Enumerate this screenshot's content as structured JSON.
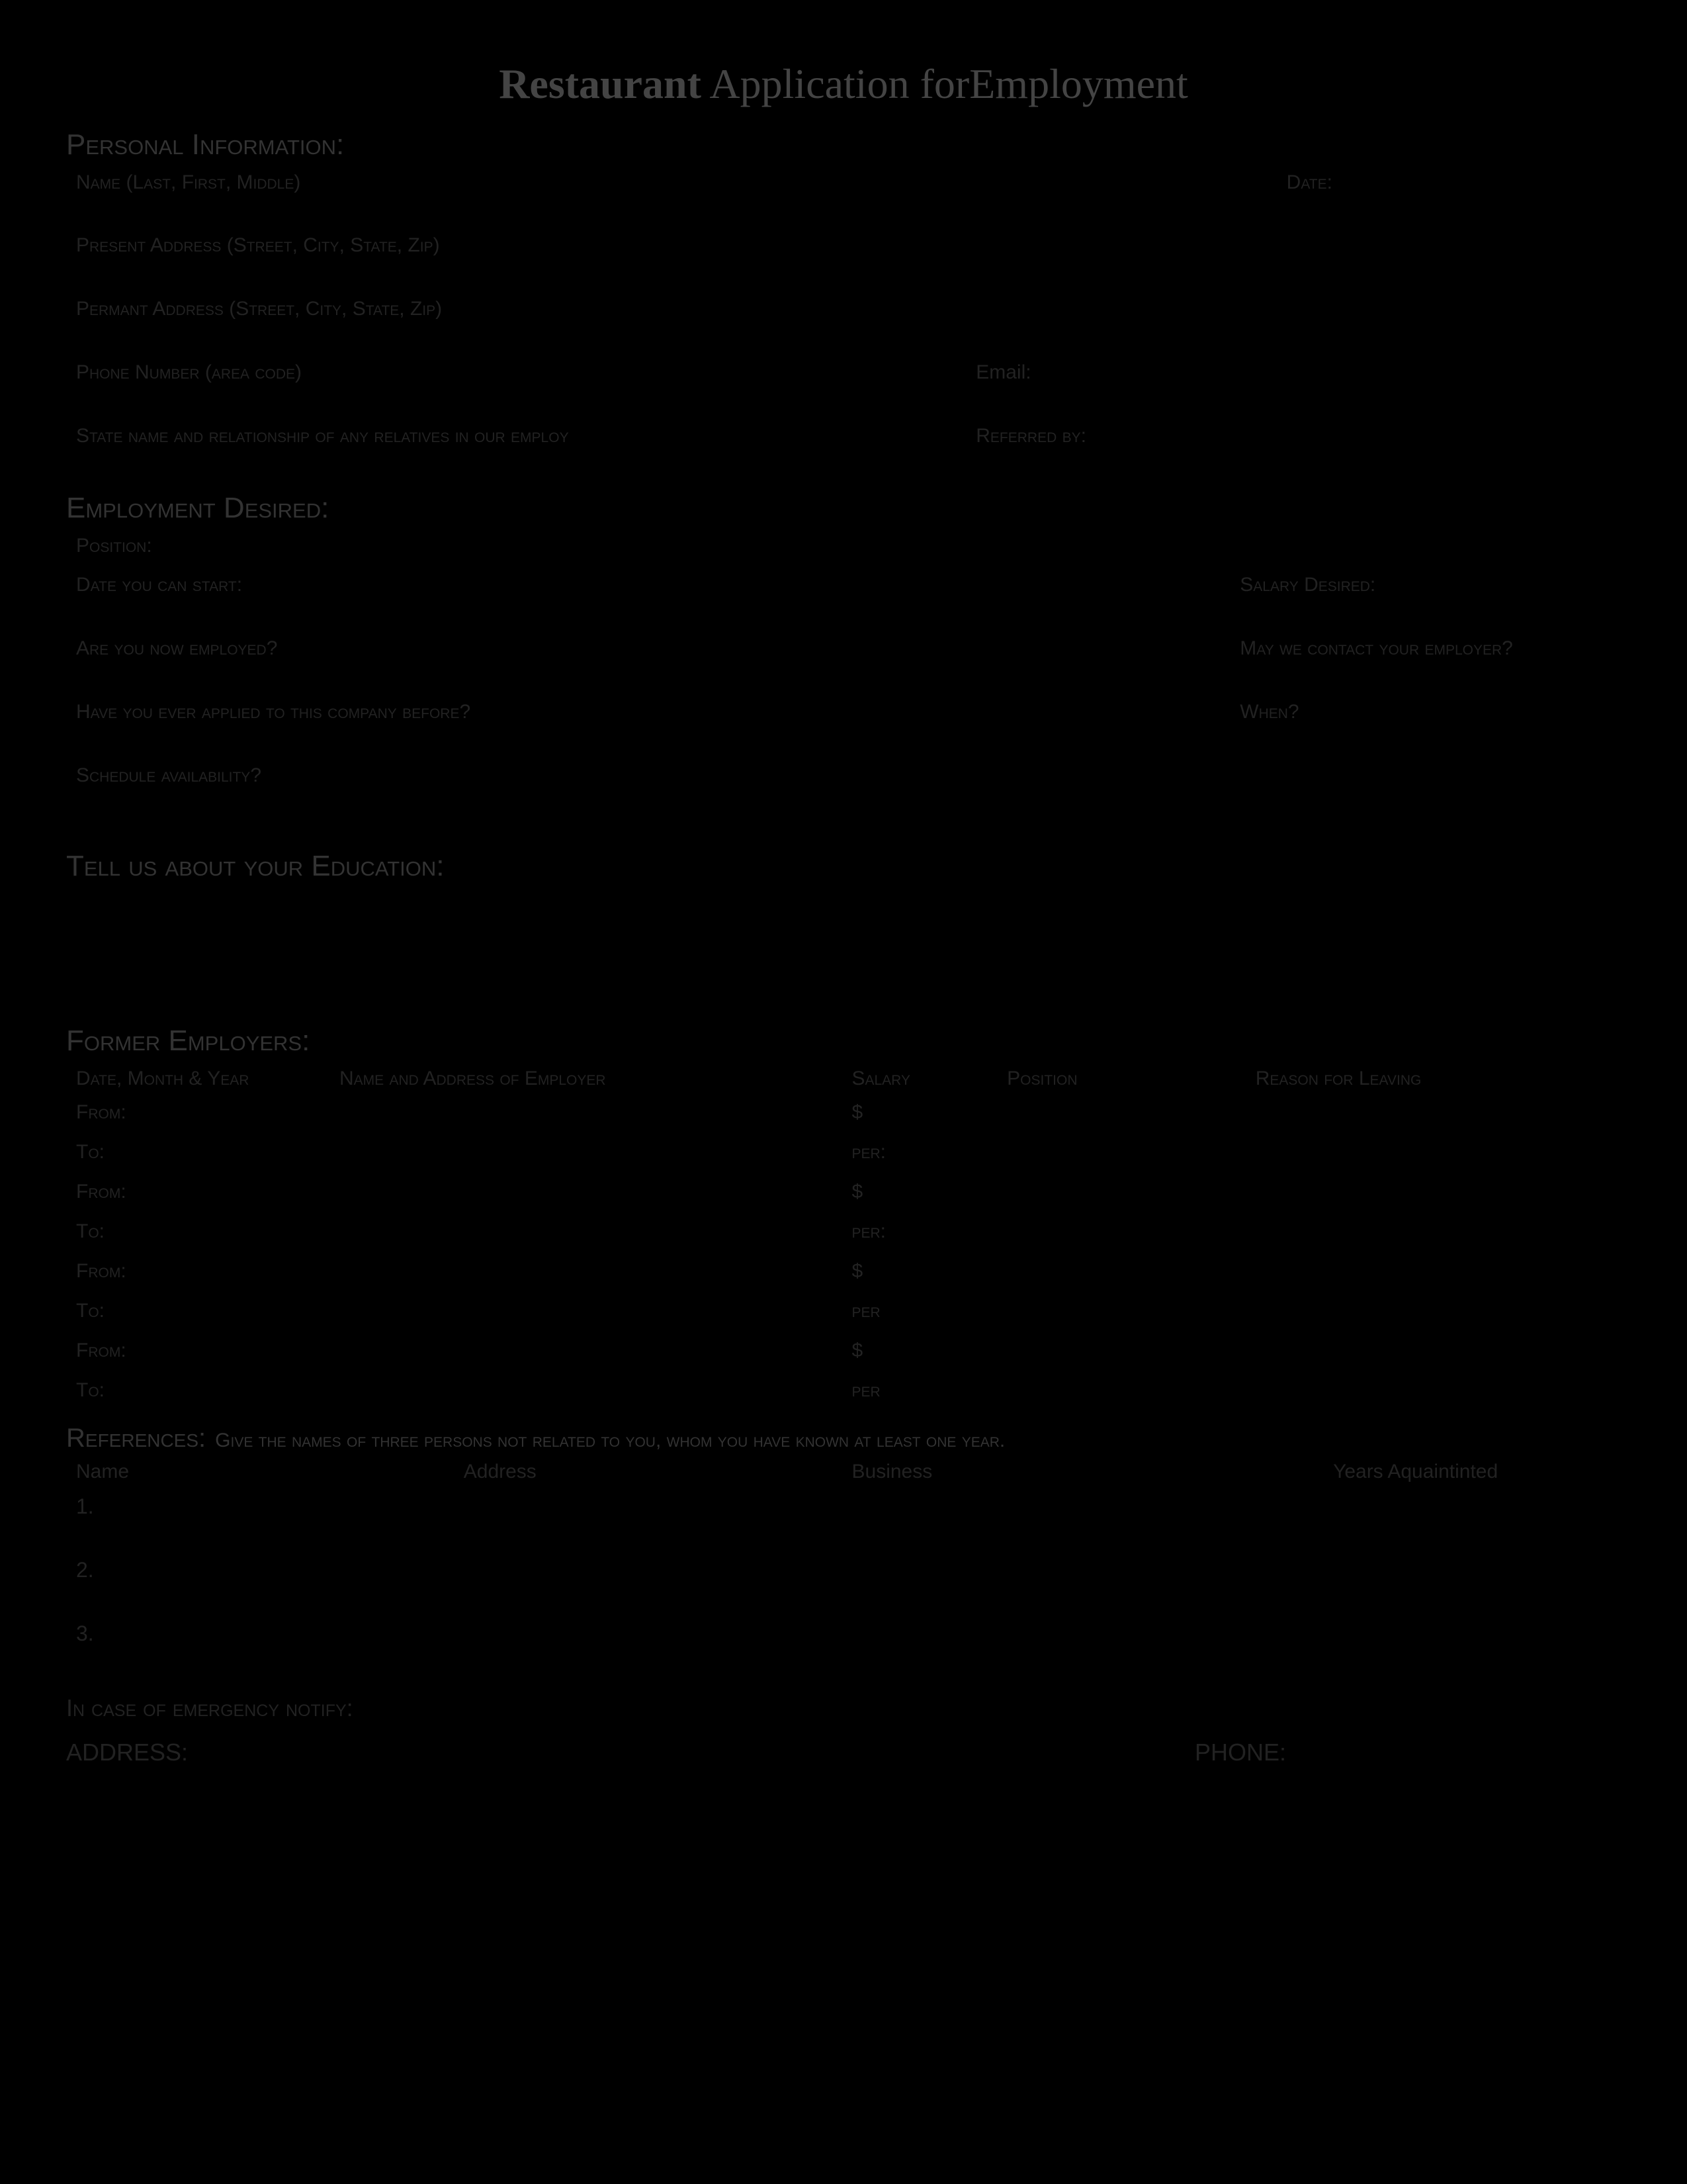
{
  "title_part1": "Restaurant",
  "title_part2": " Application for",
  "title_part3": "Employment",
  "sections": {
    "personal": {
      "heading": "Personal Information:",
      "name_label": "Name (Last, First, Middle)",
      "date_label": "Date:",
      "present_address_label": "Present Address (Street, City, State, Zip)",
      "permanent_address_label": "Permant Address (Street, City, State, Zip)",
      "phone_label": "Phone Number (area code)",
      "email_label": "Email:",
      "relatives_label": "State name and relationship of any relatives in our employ",
      "referred_label": "Referred by:"
    },
    "employment": {
      "heading": "Employment Desired:",
      "position_label": "Position:",
      "start_date_label": "Date you can start:",
      "salary_label": "Salary Desired:",
      "employed_label": "Are you now employed?",
      "contact_label": "May we contact your employer?",
      "applied_label": "Have you ever applied to this company before?",
      "when_label": "When?",
      "schedule_label": "Schedule availability?"
    },
    "education": {
      "heading": "Tell us about your Education:"
    },
    "former_employers": {
      "heading": "Former Employers:",
      "headers": {
        "date": "Date, Month & Year",
        "name": "Name and Address of Employer",
        "salary": "Salary",
        "position": "Position",
        "reason": "Reason for Leaving"
      },
      "from_label": "From:",
      "to_label": "To:",
      "dollar": "$",
      "per_colon": "per:",
      "per": "per"
    },
    "references": {
      "heading": "References:",
      "subtext": " Give the names of three persons not related to you, whom you have known at least one year.",
      "headers": {
        "name": "Name",
        "address": "Address",
        "business": "Business",
        "years": "Years Aquaintinted"
      },
      "nums": [
        "1.",
        "2.",
        "3."
      ]
    },
    "emergency": {
      "heading": "In case of emergency notify:",
      "address_label": "ADDRESS:",
      "phone_label": "PHONE:"
    }
  }
}
